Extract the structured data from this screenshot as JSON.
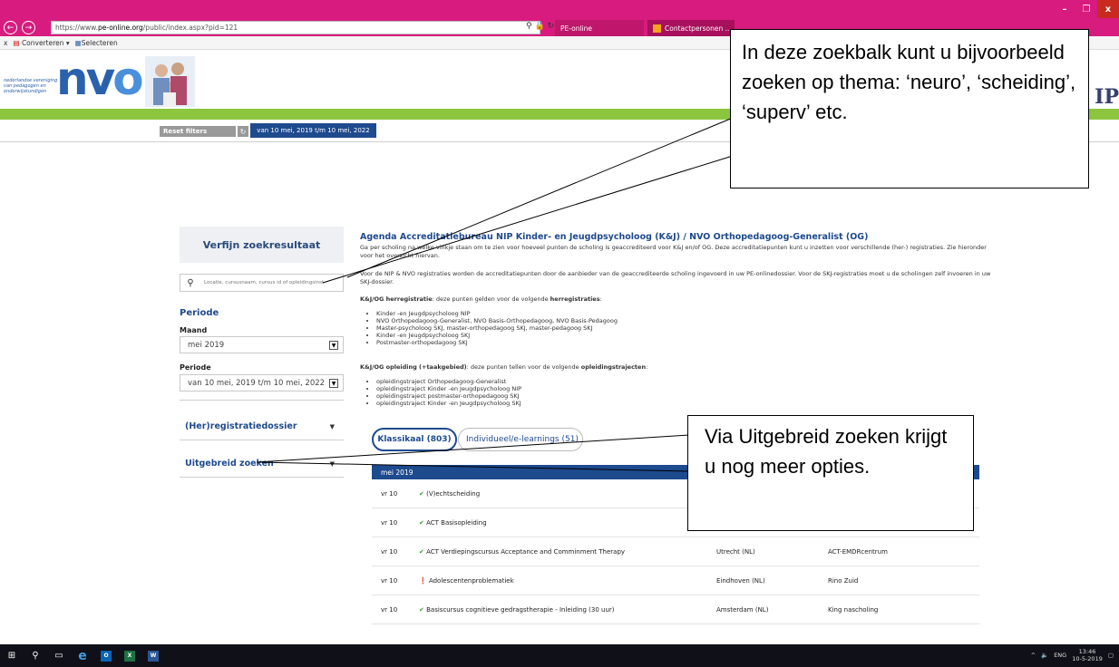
{
  "browser": {
    "url_prefix": "https://www.",
    "url_domain": "pe-online.org",
    "url_path": "/public/index.aspx?pid=121",
    "tab1": "PE-online",
    "tab2": "Contactpersonen ...",
    "cmd_convert": "Converteren",
    "cmd_select": "Selecteren",
    "minimize": "–",
    "maximize": "❐",
    "close": "x"
  },
  "header": {
    "logo_text": "nederlandse vereniging van pedagogen en onderwijskundigen",
    "nvo_n": "n",
    "nvo_v": "v",
    "nvo_o": "o",
    "nip_fragment": "IP"
  },
  "filters": {
    "reset_label": "Reset filters",
    "active_period": "van 10 mei, 2019 t/m 10 mei, 2022"
  },
  "sidebar": {
    "refine_title": "Verfijn zoekresultaat",
    "search_placeholder": "Locatie, cursusnaam, cursus id of opleidingsinst",
    "period_heading": "Periode",
    "month_label": "Maand",
    "month_value": "mei 2019",
    "period_label": "Periode",
    "period_value": "van 10 mei, 2019 t/m 10 mei, 2022",
    "acc_registration": "(Her)registratiedossier",
    "acc_extended": "Uitgebreid zoeken"
  },
  "main": {
    "title": "Agenda Accreditatiebureau NIP Kinder- en Jeugdpsycholoog (K&J) / NVO Orthopedagoog-Generalist (OG)",
    "intro": "Ga per scholing na welke vinkje staan om te zien voor hoeveel punten de scholing is geaccrediteerd voor K&J en/of OG. Deze accreditatiepunten kunt u inzetten voor verschillende (her-) registraties. Zie hieronder voor het overzicht hiervan.",
    "para2": "Voor de NIP & NVO registraties worden de accreditatiepunten door de aanbieder van de geaccrediteerde scholing ingevoerd in uw PE-onlinedossier. Voor de SKJ-registraties moet u de scholingen zelf invoeren in uw SKJ-dossier.",
    "herreg_lead": "K&J/OG herregistratie",
    "herreg_rest": ": deze punten gelden voor de volgende ",
    "herreg_bold": "herregistraties",
    "herreg_items": [
      "Kinder -en Jeugdpsycholoog NIP",
      "NVO Orthopedagoog-Generalist, NVO Basis-Orthopedagoog, NVO Basis-Pedagoog",
      "Master-psycholoog SKJ, master-orthopedagoog SKJ, master-pedagoog SKJ",
      "Kinder -en Jeugdpsycholoog SKJ",
      "Postmaster-orthopedagoog SKJ"
    ],
    "opl_lead": "K&J/OG opleiding (+taakgebied)",
    "opl_rest": ": deze punten tellen voor de volgende ",
    "opl_bold": "opleidingstrajecten",
    "opl_items": [
      "opleidingstraject Orthopedagoog-Generalist",
      "opleidingstraject Kinder -en Jeugdpsycholoog NIP",
      "opleidingstraject postmaster-orthopedagoog SKJ",
      "opleidingstraject Kinder -en Jeugdpsycholoog SKJ"
    ],
    "tab_klassikaal": "Klassikaal (803)",
    "tab_individueel": "Individueel/e-learnings (51)",
    "month_header": "mei 2019",
    "rows": [
      {
        "date": "vr 10",
        "icon": "✔",
        "title": "(V)echtscheiding",
        "location": "",
        "org": ""
      },
      {
        "date": "vr 10",
        "icon": "✔",
        "title": "ACT Basisopleiding",
        "location": "",
        "org": ""
      },
      {
        "date": "vr 10",
        "icon": "✔",
        "title": "ACT Verdiepingscursus Acceptance and Comminment Therapy",
        "location": "Utrecht (NL)",
        "org": "ACT-EMDRcentrum"
      },
      {
        "date": "vr 10",
        "icon": "❗",
        "title": "Adolescentenproblematiek",
        "location": "Eindhoven (NL)",
        "org": "Rino Zuid"
      },
      {
        "date": "vr 10",
        "icon": "✔",
        "title": "Basiscursus cognitieve gedragstherapie - Inleiding (30 uur)",
        "location": "Amsterdam (NL)",
        "org": "King nascholing"
      }
    ]
  },
  "callouts": {
    "search_tip": "In deze zoekbalk kunt u bijvoorbeeld zoeken op thema: ‘neuro’, ‘scheiding’, ‘superv’ etc.",
    "extended_tip": "Via Uitgebreid zoeken krijgt u nog meer opties."
  },
  "taskbar": {
    "lang": "ENG",
    "time": "13:46",
    "date": "10-5-2019"
  },
  "colors": {
    "browser_chrome": "#d81b7e",
    "brand_blue": "#1e4a8e",
    "green_bar": "#8cc63f"
  }
}
